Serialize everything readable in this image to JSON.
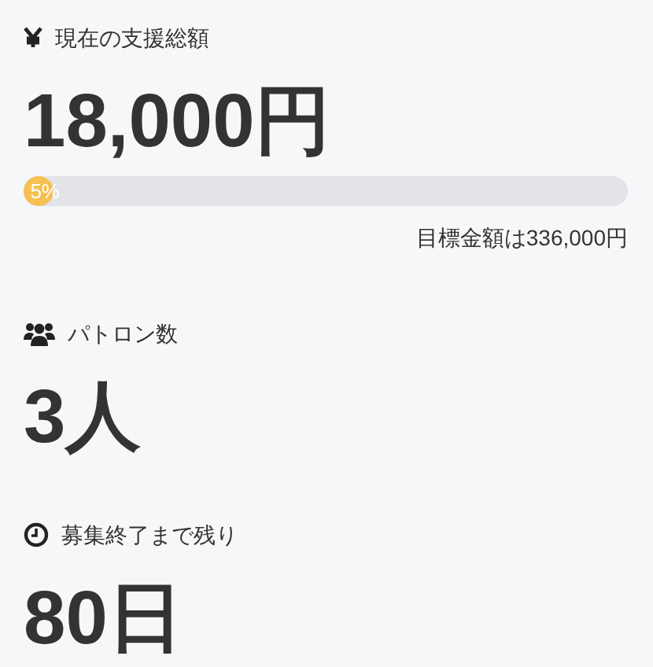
{
  "stats": [
    {
      "kind": "money",
      "label": "現在の支援総額",
      "value": "18,000円",
      "progress": {
        "level": 0.05,
        "label": "5%"
      },
      "goal": "目標金額は336,000円"
    },
    {
      "kind": "patrons",
      "label": "パトロン数",
      "value": "3人"
    },
    {
      "kind": "time",
      "label": "募集終了まで残り",
      "value": "80日"
    }
  ]
}
